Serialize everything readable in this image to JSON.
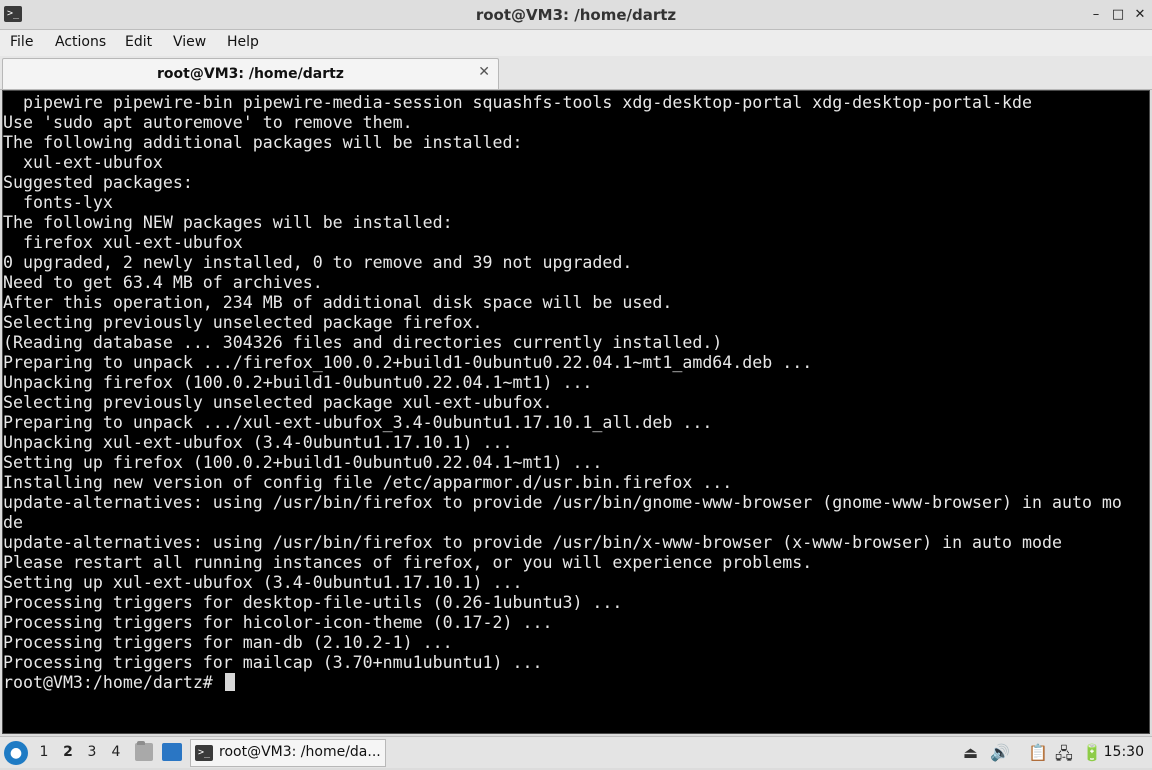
{
  "window": {
    "title": "root@VM3: /home/dartz",
    "icon": "terminal-icon",
    "minimize": "–",
    "maximize": "□",
    "close": "✕"
  },
  "menu": [
    "File",
    "Actions",
    "Edit",
    "View",
    "Help"
  ],
  "tab": {
    "label": "root@VM3: /home/dartz",
    "close": "✕"
  },
  "terminal": {
    "background": "#000000",
    "foreground": "#e8e8e8",
    "lines": [
      "  pipewire pipewire-bin pipewire-media-session squashfs-tools xdg-desktop-portal xdg-desktop-portal-kde",
      "Use 'sudo apt autoremove' to remove them.",
      "The following additional packages will be installed:",
      "  xul-ext-ubufox",
      "Suggested packages:",
      "  fonts-lyx",
      "The following NEW packages will be installed:",
      "  firefox xul-ext-ubufox",
      "0 upgraded, 2 newly installed, 0 to remove and 39 not upgraded.",
      "Need to get 63.4 MB of archives.",
      "After this operation, 234 MB of additional disk space will be used.",
      "Selecting previously unselected package firefox.",
      "(Reading database ... 304326 files and directories currently installed.)",
      "Preparing to unpack .../firefox_100.0.2+build1-0ubuntu0.22.04.1~mt1_amd64.deb ...",
      "Unpacking firefox (100.0.2+build1-0ubuntu0.22.04.1~mt1) ...",
      "Selecting previously unselected package xul-ext-ubufox.",
      "Preparing to unpack .../xul-ext-ubufox_3.4-0ubuntu1.17.10.1_all.deb ...",
      "Unpacking xul-ext-ubufox (3.4-0ubuntu1.17.10.1) ...",
      "Setting up firefox (100.0.2+build1-0ubuntu0.22.04.1~mt1) ...",
      "Installing new version of config file /etc/apparmor.d/usr.bin.firefox ...",
      "update-alternatives: using /usr/bin/firefox to provide /usr/bin/gnome-www-browser (gnome-www-browser) in auto mo",
      "de",
      "update-alternatives: using /usr/bin/firefox to provide /usr/bin/x-www-browser (x-www-browser) in auto mode",
      "Please restart all running instances of firefox, or you will experience problems.",
      "Setting up xul-ext-ubufox (3.4-0ubuntu1.17.10.1) ...",
      "Processing triggers for desktop-file-utils (0.26-1ubuntu3) ...",
      "Processing triggers for hicolor-icon-theme (0.17-2) ...",
      "Processing triggers for man-db (2.10.2-1) ...",
      "Processing triggers for mailcap (3.70+nmu1ubuntu1) ..."
    ],
    "prompt": "root@VM3:/home/dartz# "
  },
  "taskbar": {
    "workspaces": [
      "1",
      "2",
      "3",
      "4"
    ],
    "active_workspace": "2",
    "task_label": "root@VM3: /home/da...",
    "clock": "15:30",
    "tray_icons": [
      "eject-icon",
      "volume-icon",
      "clipboard-icon",
      "network-icon",
      "battery-icon"
    ]
  }
}
